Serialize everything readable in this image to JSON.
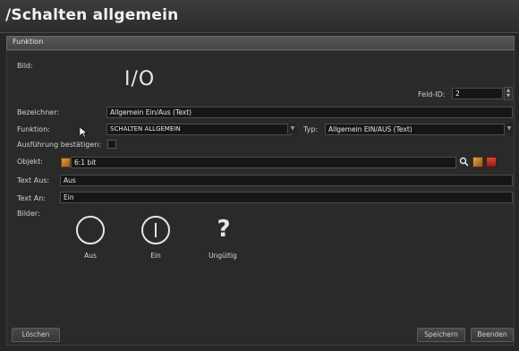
{
  "window": {
    "title": "/Schalten allgemein"
  },
  "section": {
    "title": "Funktion"
  },
  "form": {
    "bild_label": "Bild:",
    "bild_text": "I/O",
    "feld_id_label": "Feld-ID:",
    "feld_id_value": "2",
    "bezeichner_label": "Bezeichner:",
    "bezeichner_value": "Allgemein Ein/Aus (Text)",
    "funktion_label": "Funktion:",
    "funktion_value": "SCHALTEN ALLGEMEIN",
    "typ_label": "Typ:",
    "typ_value": "Allgemein EIN/AUS (Text)",
    "ausfuehrung_label": "Ausführung bestätigen:",
    "ausfuehrung_checked": false,
    "objekt_label": "Objekt:",
    "objekt_value": "6:1 bit",
    "text_aus_label": "Text Aus:",
    "text_aus_value": "Aus",
    "text_an_label": "Text An:",
    "text_an_value": "Ein",
    "bilder_label": "Bilder:"
  },
  "images": [
    {
      "label": "Aus",
      "icon": "circle-off-icon"
    },
    {
      "label": "Ein",
      "icon": "power-on-icon"
    },
    {
      "label": "Ungültig",
      "icon": "question-icon"
    }
  ],
  "buttons": {
    "loeschen": "Löschen",
    "speichern": "Speichern",
    "beenden": "Beenden"
  },
  "colors": {
    "background": "#262626",
    "field_bg": "#161616",
    "object_icon": "#c98a2a",
    "delete_icon": "#c0302a"
  }
}
